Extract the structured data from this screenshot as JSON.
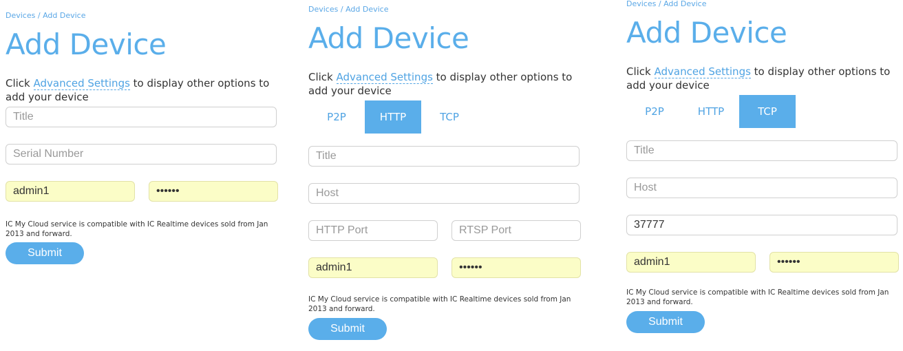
{
  "breadcrumb": {
    "devices": "Devices",
    "separator": " / ",
    "current": "Add Device"
  },
  "page_title": "Add Device",
  "intro": {
    "before": "Click ",
    "link": "Advanced Settings",
    "after": " to display other options to add your device"
  },
  "tabs": {
    "p2p": "P2P",
    "http": "HTTP",
    "tcp": "TCP"
  },
  "placeholders": {
    "title": "Title",
    "serial": "Serial Number",
    "host": "Host",
    "http_port": "HTTP Port",
    "rtsp_port": "RTSP Port"
  },
  "values": {
    "username": "admin1",
    "password_mask": "••••••",
    "tcp_port": "37777"
  },
  "compat_note": "IC My Cloud service is compatible with IC Realtime devices sold from Jan 2013 and forward.",
  "submit_label": "Submit",
  "colors": {
    "accent": "#5aaeea",
    "autofill": "#fbfdc7",
    "link": "#4fa3e3"
  },
  "panels": [
    {
      "view": "default",
      "active_tab": "none"
    },
    {
      "view": "http",
      "active_tab": "HTTP"
    },
    {
      "view": "tcp",
      "active_tab": "TCP"
    }
  ]
}
